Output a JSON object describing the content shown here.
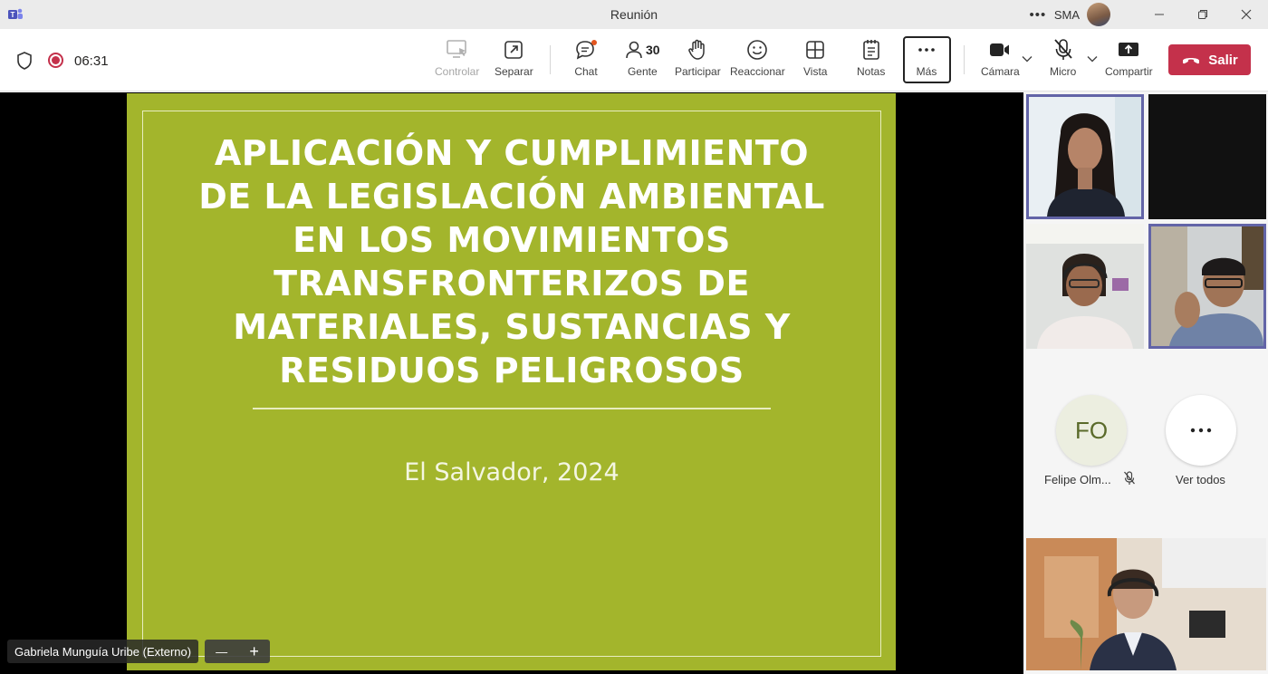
{
  "window": {
    "title": "Reunión",
    "user": "SMA"
  },
  "meeting": {
    "timer": "06:31"
  },
  "toolbar": {
    "controlar": "Controlar",
    "separar": "Separar",
    "chat": "Chat",
    "gente": "Gente",
    "people_count": "30",
    "participar": "Participar",
    "reaccionar": "Reaccionar",
    "vista": "Vista",
    "notas": "Notas",
    "mas": "Más",
    "camara": "Cámara",
    "micro": "Micro",
    "compartir": "Compartir",
    "salir": "Salir"
  },
  "slide": {
    "title_lines": [
      "APLICACIÓN Y CUMPLIMIENTO",
      "DE LA LEGISLACIÓN AMBIENTAL",
      "EN LOS MOVIMIENTOS",
      "TRANSFRONTERIZOS DE",
      "MATERIALES, SUSTANCIAS Y",
      "RESIDUOS PELIGROSOS"
    ],
    "subtitle": "El Salvador, 2024"
  },
  "stage": {
    "presenter_label": "Gabriela Munguía Uribe (Externo)",
    "zoom_out": "—",
    "zoom_in": "+"
  },
  "participants": {
    "initials": "FO",
    "name": "Felipe Olm...",
    "view_all": "Ver todos"
  },
  "colors": {
    "slide_bg": "#a3b52c",
    "leave_red": "#c4314b",
    "active_border": "#6264a7"
  }
}
